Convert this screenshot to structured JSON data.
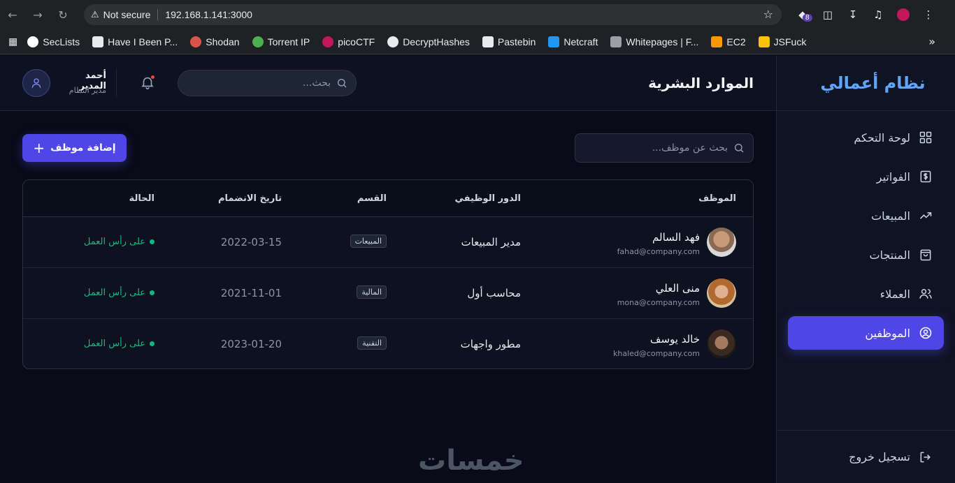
{
  "browser": {
    "security_label": "Not secure",
    "url": "192.168.1.141:3000",
    "ext_badge": "8",
    "bookmarks": [
      {
        "label": "SecLists",
        "color": "#ffffff"
      },
      {
        "label": "Have I Been P...",
        "color": "#e8eaed"
      },
      {
        "label": "Shodan",
        "color": "#d9534f"
      },
      {
        "label": "Torrent IP",
        "color": "#4caf50"
      },
      {
        "label": "picoCTF",
        "color": "#c2185b"
      },
      {
        "label": "DecryptHashes",
        "color": "#e8eaed"
      },
      {
        "label": "Pastebin",
        "color": "#e8eaed"
      },
      {
        "label": "Netcraft",
        "color": "#2196f3"
      },
      {
        "label": "Whitepages | F...",
        "color": "#9aa0a6"
      },
      {
        "label": "EC2",
        "color": "#ff9800"
      },
      {
        "label": "JSFuck",
        "color": "#ffc107"
      }
    ]
  },
  "sidebar": {
    "brand": "نظام أعمالي",
    "items": [
      {
        "label": "لوحة التحكم",
        "icon": "grid-icon"
      },
      {
        "label": "الفواتير",
        "icon": "dollar-icon"
      },
      {
        "label": "المبيعات",
        "icon": "trending-icon"
      },
      {
        "label": "المنتجات",
        "icon": "bag-icon"
      },
      {
        "label": "العملاء",
        "icon": "users-icon"
      },
      {
        "label": "الموظفين",
        "icon": "user-circle-icon"
      }
    ],
    "active_index": 5,
    "logout": "تسجيل خروج"
  },
  "header": {
    "title": "الموارد البشرية",
    "search_placeholder": "بحث...",
    "user_name": "أحمد المدير",
    "user_role": "مدير النظام"
  },
  "toolbar": {
    "search_placeholder": "بحث عن موظف...",
    "add_label": "إضافة موظف"
  },
  "table": {
    "columns": {
      "employee": "الموظف",
      "role": "الدور الوظيفي",
      "dept": "القسم",
      "joined": "تاريخ الانضمام",
      "status": "الحالة"
    },
    "rows": [
      {
        "name": "فهد السالم",
        "email": "fahad@company.com",
        "role": "مدير المبيعات",
        "dept": "المبيعات",
        "joined": "2022-03-15",
        "status": "على رأس العمل"
      },
      {
        "name": "منى العلي",
        "email": "mona@company.com",
        "role": "محاسب أول",
        "dept": "المالية",
        "joined": "2021-11-01",
        "status": "على رأس العمل"
      },
      {
        "name": "خالد يوسف",
        "email": "khaled@company.com",
        "role": "مطور واجهات",
        "dept": "التقنية",
        "joined": "2023-01-20",
        "status": "على رأس العمل"
      }
    ]
  },
  "watermark": "خمسات"
}
